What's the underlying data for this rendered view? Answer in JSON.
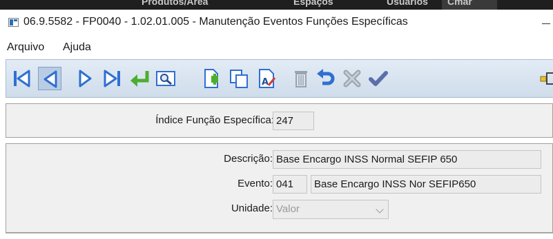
{
  "background_window": {
    "tabs": [
      "Produtos/Area",
      "Espaços",
      "Usuários",
      "Cmar"
    ]
  },
  "window": {
    "title": "06.9.5582 - FP0040 - 1.02.01.005 - Manutenção Eventos Funções Específicas"
  },
  "menu": {
    "items": [
      "Arquivo",
      "Ajuda"
    ]
  },
  "toolbar": {
    "buttons": [
      {
        "name": "first-record",
        "icon": "first-record-icon"
      },
      {
        "name": "previous-record",
        "icon": "previous-record-icon"
      },
      {
        "name": "next-record",
        "icon": "next-record-icon"
      },
      {
        "name": "last-record",
        "icon": "last-record-icon"
      },
      {
        "name": "go-to",
        "icon": "enter-arrow-icon"
      },
      {
        "name": "search",
        "icon": "magnifier-icon"
      },
      {
        "name": "new",
        "icon": "new-document-icon"
      },
      {
        "name": "copy",
        "icon": "copy-icon"
      },
      {
        "name": "edit",
        "icon": "edit-document-icon"
      },
      {
        "name": "delete",
        "icon": "trash-icon"
      },
      {
        "name": "undo",
        "icon": "undo-icon"
      },
      {
        "name": "cancel",
        "icon": "cancel-x-icon"
      },
      {
        "name": "save",
        "icon": "checkmark-icon"
      },
      {
        "name": "exit",
        "icon": "exit-icon"
      }
    ],
    "colors": {
      "nav_blue": "#2f6fd1",
      "green": "#4cae2e",
      "gray": "#9aa3ad"
    }
  },
  "header_panel": {
    "indice_label": "Índice Função Específica:",
    "indice_value": "247"
  },
  "detail_panel": {
    "descricao_label": "Descrição:",
    "descricao_value": "Base Encargo INSS Normal SEFIP 650",
    "evento_label": "Evento:",
    "evento_code": "041",
    "evento_desc": "Base Encargo INSS Nor SEFIP650",
    "unidade_label": "Unidade:",
    "unidade_value": "Valor"
  }
}
